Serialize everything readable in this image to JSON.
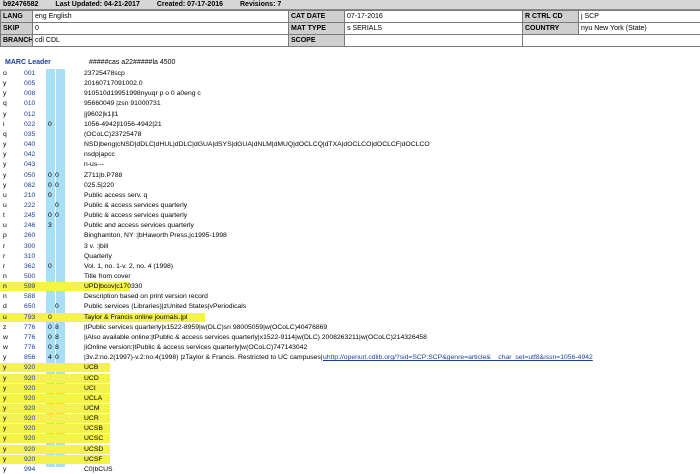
{
  "header": {
    "record_id": "b92476582",
    "last_updated": "Last Updated: 04-21-2017",
    "created": "Created: 07-17-2016",
    "revisions": "Revisions: 7"
  },
  "fields": {
    "lang_label": "LANG",
    "lang_value": "eng  English",
    "cat_date_label": "CAT DATE",
    "cat_date_value": "07-17-2016",
    "r_ctrl_cd_label": "R CTRL CD",
    "r_ctrl_cd_value": "j  SCP",
    "skip_label": "SKIP",
    "skip_value": "0",
    "mat_type_label": "MAT TYPE",
    "mat_type_value": "s  SERIALS",
    "country_label": "COUNTRY",
    "country_value": "nyu  New York (State)",
    "branch_label": "BRANCH",
    "branch_value": "cdl   CDL",
    "scope_label": "SCOPE",
    "scope_value": ""
  },
  "leader": {
    "label": "MARC Leader",
    "value": "#####cas a22#####la 4500"
  },
  "colors": {
    "highlight": "#f5f24d",
    "stripe": "#a9dff4",
    "accent": "#1c3e9a"
  },
  "rows": [
    {
      "tag": "o",
      "field": "001",
      "i1": "",
      "i2": "",
      "text": "23725478scp",
      "hl": false
    },
    {
      "tag": "y",
      "field": "005",
      "i1": "",
      "i2": "",
      "text": "20160717091002.0",
      "hl": false
    },
    {
      "tag": "y",
      "field": "008",
      "i1": "",
      "i2": "",
      "text": "910510d19951998nyuqr p o     0    a0eng c",
      "hl": false
    },
    {
      "tag": "q",
      "field": "010",
      "i1": "",
      "i2": "",
      "text": "95660049 |zsn 91000731",
      "hl": false
    },
    {
      "tag": "y",
      "field": "012",
      "i1": "",
      "i2": "",
      "text": "|j9602|k1|l1",
      "hl": false
    },
    {
      "tag": "i",
      "field": "022",
      "i1": "0",
      "i2": "",
      "text": "1056-4942|l1056-4942|21",
      "hl": false
    },
    {
      "tag": "q",
      "field": "035",
      "i1": "",
      "i2": "",
      "text": "(OCoLC)23725478",
      "hl": false
    },
    {
      "tag": "y",
      "field": "040",
      "i1": "",
      "i2": "",
      "text": "NSD|beng|cNSD|dDLC|dHUL|dDLC|dGUA|dSYS|dGUA|dNLM|dMUQ|dOCLCQ|dTXA|dOCLCO|dOCLCF|dOCLCO",
      "hl": false
    },
    {
      "tag": "y",
      "field": "042",
      "i1": "",
      "i2": "",
      "text": "nsdp|apcc",
      "hl": false
    },
    {
      "tag": "y",
      "field": "043",
      "i1": "",
      "i2": "",
      "text": "n-us---",
      "hl": false
    },
    {
      "tag": "y",
      "field": "050",
      "i1": "0",
      "i2": "0",
      "text": "Z711|b.P788",
      "hl": false
    },
    {
      "tag": "y",
      "field": "082",
      "i1": "0",
      "i2": "0",
      "text": "025.5|220",
      "hl": false
    },
    {
      "tag": "u",
      "field": "210",
      "i1": "0",
      "i2": "",
      "text": "Public access serv. q",
      "hl": false
    },
    {
      "tag": "u",
      "field": "222",
      "i1": "",
      "i2": "0",
      "text": "Public & access services quarterly",
      "hl": false
    },
    {
      "tag": "t",
      "field": "245",
      "i1": "0",
      "i2": "0",
      "text": "Public & access services quarterly",
      "hl": false
    },
    {
      "tag": "u",
      "field": "246",
      "i1": "3",
      "i2": "",
      "text": "Public and access services quarterly",
      "hl": false
    },
    {
      "tag": "p",
      "field": "260",
      "i1": "",
      "i2": "",
      "text": "Binghamton, NY :|bHaworth Press,|c1995-1998",
      "hl": false
    },
    {
      "tag": "r",
      "field": "300",
      "i1": "",
      "i2": "",
      "text": "3 v. :|bill",
      "hl": false
    },
    {
      "tag": "r",
      "field": "310",
      "i1": "",
      "i2": "",
      "text": "Quarterly",
      "hl": false
    },
    {
      "tag": "r",
      "field": "362",
      "i1": "0",
      "i2": "",
      "text": "Vol. 1, no. 1-v. 2, no. 4 (1998)",
      "hl": false
    },
    {
      "tag": "n",
      "field": "500",
      "i1": "",
      "i2": "",
      "text": "Title from cover",
      "hl": false
    },
    {
      "tag": "n",
      "field": "599",
      "i1": "",
      "i2": "",
      "text": "UPD|bcov|c170330",
      "hl": true,
      "hlw": 130
    },
    {
      "tag": "n",
      "field": "588",
      "i1": "",
      "i2": "",
      "text": "Description based on print version record",
      "hl": false
    },
    {
      "tag": "d",
      "field": "650",
      "i1": "",
      "i2": "0",
      "text": "Public services (Libraries)|zUnited States|vPeriodicals",
      "hl": false
    },
    {
      "tag": "u",
      "field": "793",
      "i1": "0",
      "i2": "",
      "text": "Taylor & Francis online journals.|pl",
      "hl": true,
      "hlw": 205
    },
    {
      "tag": "z",
      "field": "776",
      "i1": "0",
      "i2": "8",
      "text": "|tPublic services quarterly|x1522-8959|w(DLC)sn 98005059|w(OCoLC)40476869",
      "hl": false
    },
    {
      "tag": "w",
      "field": "776",
      "i1": "0",
      "i2": "8",
      "text": "|iAlso available online:|tPublic & access services quarterly|x1522-9114|w(DLC)  2008263211|w(OCoLC)214326458",
      "hl": false
    },
    {
      "tag": "w",
      "field": "776",
      "i1": "0",
      "i2": "8",
      "text": "|iOnline version:|tPublic & access services quarterly|w(OCoLC)747143042",
      "hl": false
    },
    {
      "tag": "y",
      "field": "856",
      "i1": "4",
      "i2": "0",
      "text": "|3v.2:no.2(1997)-v.2:no.4(1998) |zTaylor & Francis. Restricted to UC campuses|",
      "url": "uhttp://openurl.cdlib.org/?sid=SCP:SCP&genre=article&__char_set=utf8&issn=1056-4942",
      "hl": false
    },
    {
      "tag": "y",
      "field": "920",
      "i1": "",
      "i2": "",
      "text": "UCB",
      "hl": true,
      "hlw": 110
    },
    {
      "tag": "y",
      "field": "920",
      "i1": "",
      "i2": "",
      "text": "UCD",
      "hl": true,
      "hlw": 110
    },
    {
      "tag": "y",
      "field": "920",
      "i1": "",
      "i2": "",
      "text": "UCI",
      "hl": true,
      "hlw": 110
    },
    {
      "tag": "y",
      "field": "920",
      "i1": "",
      "i2": "",
      "text": "UCLA",
      "hl": true,
      "hlw": 110
    },
    {
      "tag": "y",
      "field": "920",
      "i1": "",
      "i2": "",
      "text": "UCM",
      "hl": true,
      "hlw": 110
    },
    {
      "tag": "y",
      "field": "920",
      "i1": "",
      "i2": "",
      "text": "UCR",
      "hl": true,
      "hlw": 110
    },
    {
      "tag": "y",
      "field": "920",
      "i1": "",
      "i2": "",
      "text": "UCSB",
      "hl": true,
      "hlw": 110
    },
    {
      "tag": "y",
      "field": "920",
      "i1": "",
      "i2": "",
      "text": "UCSC",
      "hl": true,
      "hlw": 110
    },
    {
      "tag": "y",
      "field": "920",
      "i1": "",
      "i2": "",
      "text": "UCSD",
      "hl": true,
      "hlw": 110
    },
    {
      "tag": "y",
      "field": "920",
      "i1": "",
      "i2": "",
      "text": "UCSF",
      "hl": true,
      "hlw": 110
    },
    {
      "tag": "y",
      "field": "994",
      "i1": "",
      "i2": "",
      "text": "C0|bCUS",
      "hl": false
    }
  ]
}
